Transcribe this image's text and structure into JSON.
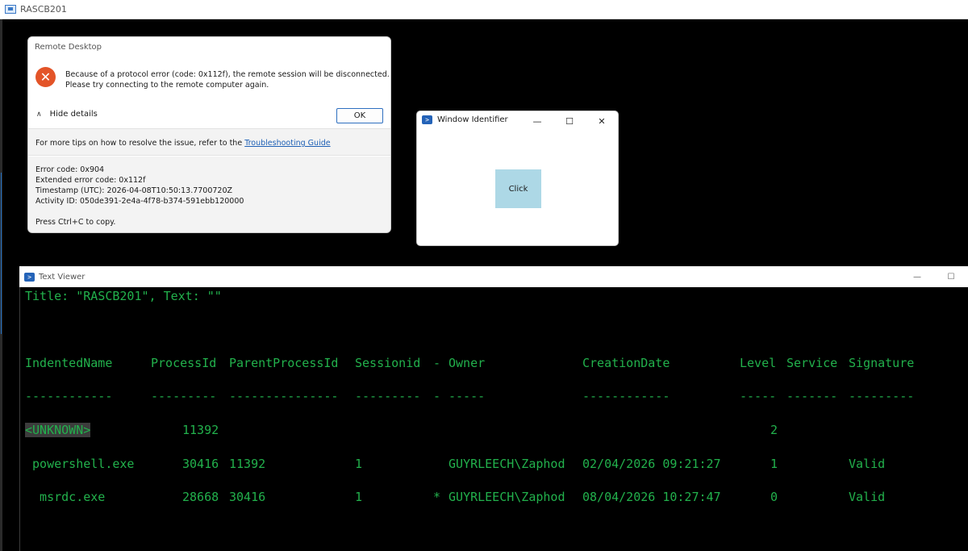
{
  "top_window": {
    "title": "RASCB201"
  },
  "remote_desktop": {
    "title": "Remote Desktop",
    "message_line1": "Because of a protocol error (code: 0x112f), the remote session will be disconnected.",
    "message_line2": "Please try connecting to the remote computer again.",
    "hide_details": "Hide details",
    "ok": "OK",
    "tips_prefix": "For more tips on how to resolve the issue, refer to the ",
    "tips_link": "Troubleshooting Guide",
    "error_code": "Error code: 0x904",
    "extended_error_code": "Extended error code: 0x112f",
    "timestamp": "Timestamp (UTC): 2026-04-08T10:50:13.7700720Z",
    "activity_id": "Activity ID: 050de391-2e4a-4f78-b374-591ebb120000",
    "copy_hint": "Press Ctrl+C to copy.",
    "error_icon": "error-x-icon"
  },
  "window_identifier": {
    "title": "Window Identifier",
    "click_label": "Click",
    "minimize": "—",
    "maximize": "☐",
    "close": "✕",
    "icon": "powershell-icon"
  },
  "text_viewer": {
    "title": "Text Viewer",
    "minimize": "—",
    "maximize": "☐",
    "title_line": "Title: \"RASCB201\", Text: \"\"",
    "headers": [
      "IndentedName",
      "ProcessId",
      "ParentProcessId",
      "Sessionid",
      "-",
      "Owner",
      "CreationDate",
      "Level",
      "Service",
      "Signature"
    ],
    "underlines": [
      "------------",
      "---------",
      "---------------",
      "---------",
      "-",
      "-----",
      "------------",
      "-----",
      "-------",
      "---------"
    ],
    "rows": [
      {
        "name": "<UNKNOWN>",
        "pid": "11392",
        "ppid": "",
        "session": "",
        "flag": "",
        "owner": "",
        "date": "",
        "level": "2",
        "service": "",
        "signature": ""
      },
      {
        "name": " powershell.exe",
        "pid": "30416",
        "ppid": "11392",
        "session": "1",
        "flag": "",
        "owner": "GUYRLEECH\\Zaphod",
        "date": "02/04/2026 09:21:27",
        "level": "1",
        "service": "",
        "signature": "Valid"
      },
      {
        "name": "  msrdc.exe",
        "pid": "28668",
        "ppid": "30416",
        "session": "1",
        "flag": "*",
        "owner": "GUYRLEECH\\Zaphod",
        "date": "08/04/2026 10:27:47",
        "level": "0",
        "service": "",
        "signature": "Valid"
      }
    ]
  }
}
